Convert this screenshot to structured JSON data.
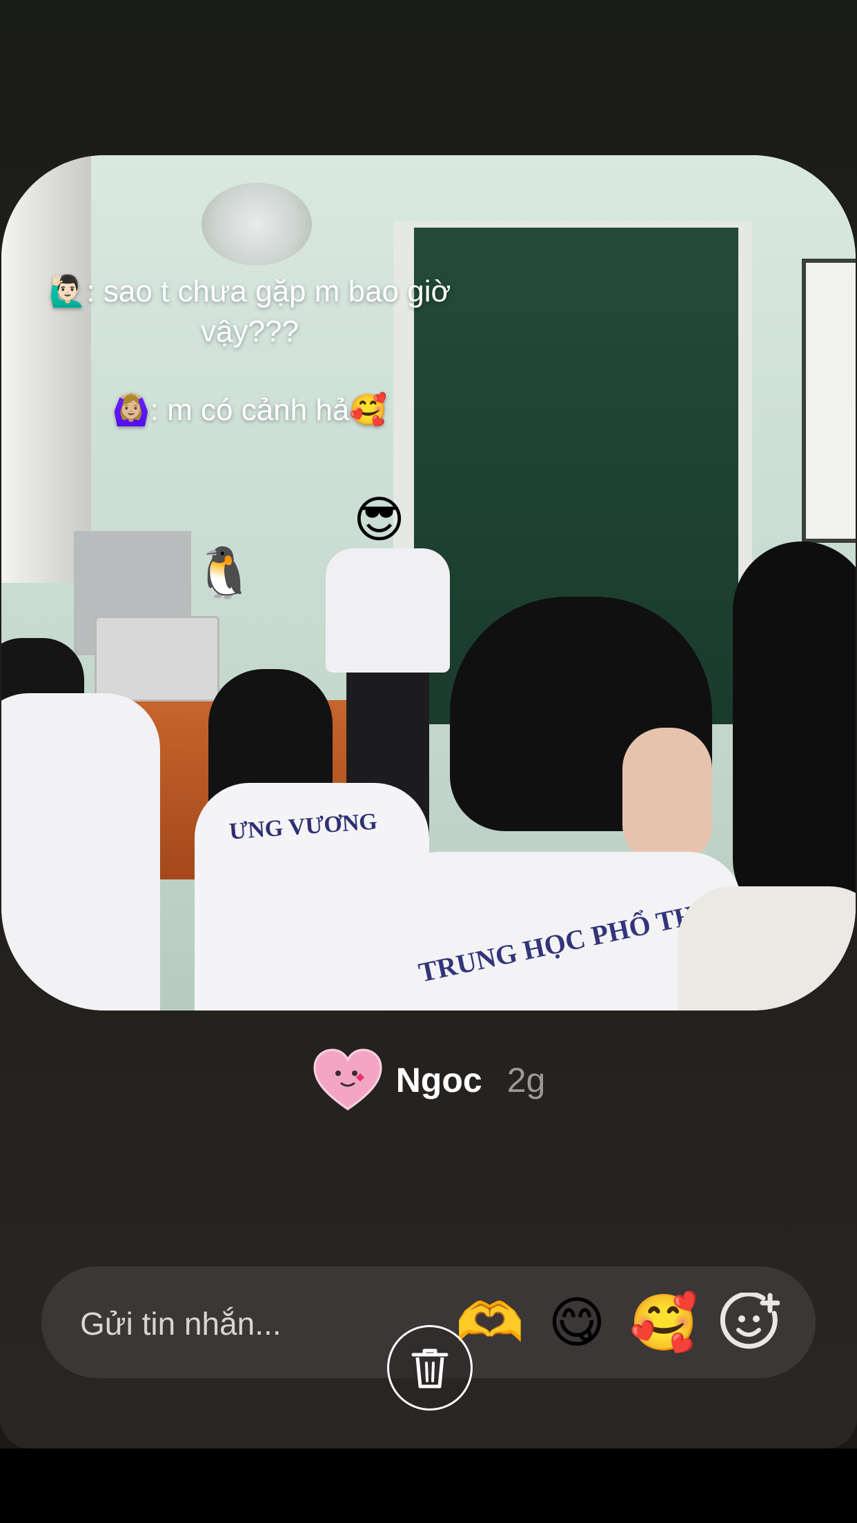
{
  "caption": {
    "line1": "🙋🏻‍♂️: sao t chưa gặp m bao giờ",
    "line2": "vậy???",
    "line3": "🙆🏼‍♀️: m có cảnh hả🥰"
  },
  "photo": {
    "print_text_1": "ƯNG VƯƠNG",
    "print_text_2": "TRUNG HỌC PHỔ THÔNG",
    "stickers": [
      "😎",
      "🐧"
    ]
  },
  "author": {
    "avatar_emoji": "💗",
    "name": "Ngoc",
    "time": "2g"
  },
  "message_bar": {
    "placeholder": "Gửi tin nhắn...",
    "reactions": [
      "🫶",
      "😋",
      "🥰"
    ],
    "add_reaction_icon": "add-emoji-icon"
  },
  "delete_icon": "trash-icon",
  "colors": {
    "background": "#201d1b",
    "message_bar": "#3a3736",
    "text": "#ffffff",
    "muted_text": "#9c9a98"
  }
}
